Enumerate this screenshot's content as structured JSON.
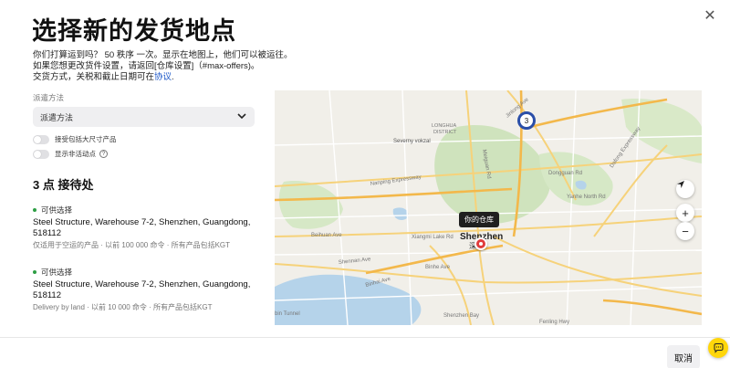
{
  "dialog": {
    "title": "选择新的发货地点",
    "desc_line1": "你们打算运到吗？ 50 秩序 一次。显示在地图上，他们可以被运往。",
    "desc_line2": "如果您想更改货件设置，请返回[仓库设置]（#max-offers)。",
    "desc_line3": "交货方式，关税和截止日期可在",
    "desc_link": "协议",
    "desc_end": "."
  },
  "shipping": {
    "label": "派遣方法",
    "selected": "派遣方法"
  },
  "toggles": [
    {
      "label": "接受包括大尺寸产品"
    },
    {
      "label": "显示非活动点"
    }
  ],
  "pickup_count": "3 点 接待处",
  "pickups": [
    {
      "status": "可供选择",
      "addr1": "Steel Structure, Warehouse 7-2, Shenzhen, Guangdong,",
      "addr2": "518112",
      "meta": "仅适用于空运的产品 · 以前 100 000 命令 · 所有产品包括KGT"
    },
    {
      "status": "可供选择",
      "addr1": "Steel Structure, Warehouse 7-2, Shenzhen, Guangdong,",
      "addr2": "518112",
      "meta": "Delivery by land · 以前 10 000 命令 · 所有产品包括KGT"
    }
  ],
  "map": {
    "tooltip": "你的仓库",
    "cluster_count": "3",
    "zoom_in": "+",
    "zoom_out": "−",
    "labels": {
      "longhua": "LONGHUA",
      "district": "DISTRICT",
      "severny": "Severny vokzal",
      "nanping": "Nanping Expressway",
      "shenzhen": "Shenzhen",
      "shenzhen_cn": "深圳",
      "beihuan": "Beihuan Ave",
      "shennan": "Shennan Ave",
      "binhe": "Binhai Ave",
      "yanhe": "Yanhe North Rd",
      "dongguan": "Dongguan Rd",
      "jinlong": "Jinlong Ave",
      "shenzhen_bay": "Shenzhen Bay",
      "fenling": "Fenling Hwy",
      "binhe2": "Binhe Ave",
      "dafong": "Dafong Expressway",
      "meiguan": "Meiguan Rd",
      "xiangmi": "Xiangmi Lake Rd",
      "tunnel": "bin Tunnel"
    },
    "colors": {
      "green": "#cfe3bd",
      "water": "#b5d3ea",
      "road": "#f6d27a",
      "highway": "#f3b84b"
    }
  },
  "footer": {
    "cancel": "取消"
  }
}
